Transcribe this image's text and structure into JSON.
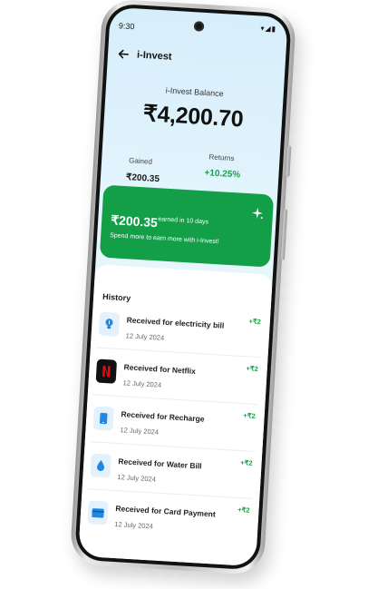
{
  "status": {
    "time": "9:30"
  },
  "topbar": {
    "title": "i-Invest"
  },
  "balance": {
    "label": "i-Invest Balance",
    "amount": "₹4,200.70"
  },
  "stats": {
    "gained_label": "Gained",
    "gained_value": "₹200.35",
    "returns_label": "Returns",
    "returns_value": "+10.25%"
  },
  "promo": {
    "amount": "₹200.35",
    "earned_text": "earned in 10 days",
    "subtext": "Spend more to earn more with i-Invest!"
  },
  "history": {
    "title": "History",
    "items": [
      {
        "title": "Received for electricity bill",
        "date": "12 July 2024",
        "amount": "+₹2",
        "icon": "bulb-icon"
      },
      {
        "title": "Received for Netflix",
        "date": "12 July 2024",
        "amount": "+₹2",
        "icon": "netflix-icon"
      },
      {
        "title": "Received for Recharge",
        "date": "12 July 2024",
        "amount": "+₹2",
        "icon": "phone-icon"
      },
      {
        "title": "Received for Water Bill",
        "date": "12 July 2024",
        "amount": "+₹2",
        "icon": "water-drop-icon"
      },
      {
        "title": "Received for Card Payment",
        "date": "12 July 2024",
        "amount": "+₹2",
        "icon": "card-icon"
      }
    ]
  },
  "colors": {
    "accent_green": "#139e48",
    "returns_green": "#1e9e4a",
    "icon_blue": "#1e88e5",
    "netflix_red": "#e50914"
  }
}
